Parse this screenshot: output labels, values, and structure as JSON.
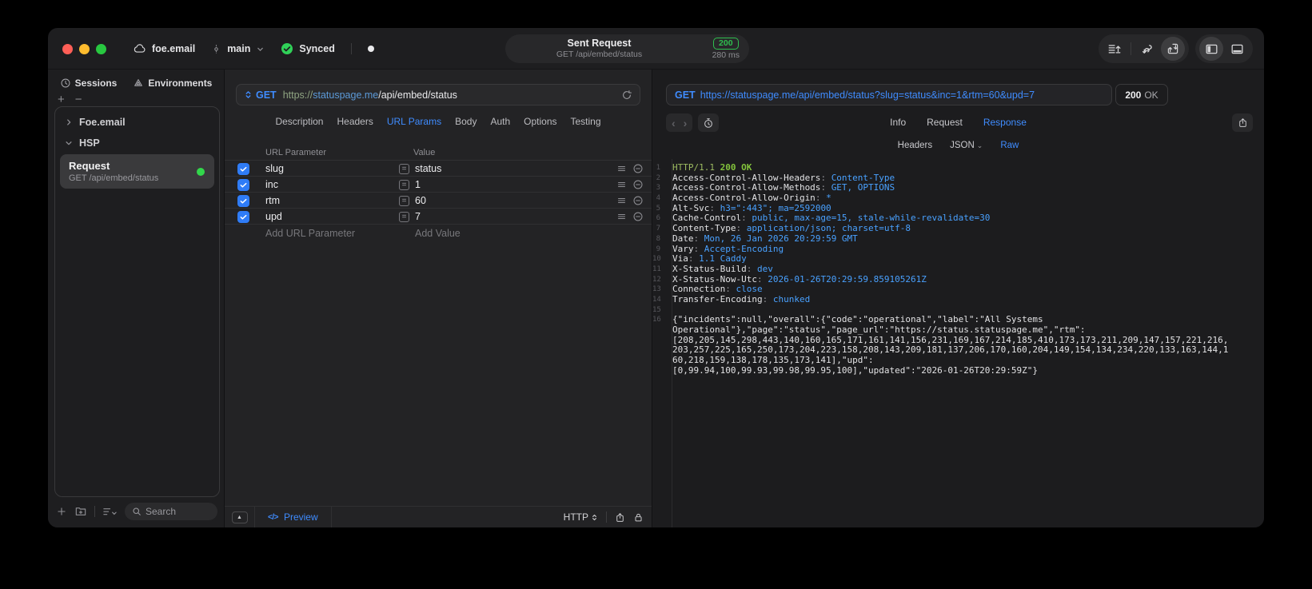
{
  "colors": {
    "accent_blue": "#3f8cff",
    "success_green": "#30d158",
    "code_value_blue": "#49a1ff",
    "code_status_green": "#83c33c"
  },
  "titlebar": {
    "project": "foe.email",
    "branch": "main",
    "sync_label": "Synced",
    "request_summary": {
      "title": "Sent Request",
      "subtitle": "GET /api/embed/status",
      "status_code": "200",
      "duration": "280 ms"
    }
  },
  "sidebar": {
    "tabs": [
      {
        "label": "Sessions",
        "icon": "history-icon"
      },
      {
        "label": "Environments",
        "icon": "environments-icon"
      }
    ],
    "tree": [
      {
        "label": "Foe.email",
        "state": "collapsed"
      },
      {
        "label": "HSP",
        "state": "expanded"
      }
    ],
    "request_item": {
      "title": "Request",
      "subtitle": "GET /api/embed/status",
      "status": "success"
    },
    "search_placeholder": "Search"
  },
  "request_editor": {
    "method": "GET",
    "url": {
      "scheme": "https://",
      "host": "statuspage.me",
      "path": "/api/embed/status"
    },
    "tabs": [
      "Description",
      "Headers",
      "URL Params",
      "Body",
      "Auth",
      "Options",
      "Testing"
    ],
    "active_tab": "URL Params",
    "params": {
      "columns": [
        "URL Parameter",
        "Value"
      ],
      "rows": [
        {
          "name": "slug",
          "value": "status",
          "checked": true
        },
        {
          "name": "inc",
          "value": "1",
          "checked": true
        },
        {
          "name": "rtm",
          "value": "60",
          "checked": true
        },
        {
          "name": "upd",
          "value": "7",
          "checked": true
        }
      ],
      "add_name_label": "Add URL Parameter",
      "add_value_label": "Add Value"
    },
    "footer": {
      "preview_label": "Preview",
      "protocol_label": "HTTP"
    }
  },
  "response_viewer": {
    "request_line": {
      "method": "GET",
      "url": "https://statuspage.me/api/embed/status?slug=status&inc=1&rtm=60&upd=7"
    },
    "status": {
      "code": "200",
      "text": "OK"
    },
    "tabs": [
      "Info",
      "Request",
      "Response"
    ],
    "active_tab": "Response",
    "subtabs": [
      "Headers",
      "JSON",
      "Raw"
    ],
    "active_subtab": "Raw",
    "raw_response": {
      "status_line": {
        "protocol": "HTTP/1.1",
        "status": "200 OK"
      },
      "headers": [
        {
          "name": "Access-Control-Allow-Headers",
          "value": "Content-Type"
        },
        {
          "name": "Access-Control-Allow-Methods",
          "value": "GET, OPTIONS"
        },
        {
          "name": "Access-Control-Allow-Origin",
          "value": "*"
        },
        {
          "name": "Alt-Svc",
          "value": "h3=\":443\"; ma=2592000"
        },
        {
          "name": "Cache-Control",
          "value": "public, max-age=15, stale-while-revalidate=30"
        },
        {
          "name": "Content-Type",
          "value": "application/json; charset=utf-8"
        },
        {
          "name": "Date",
          "value": "Mon, 26 Jan 2026 20:29:59 GMT"
        },
        {
          "name": "Vary",
          "value": "Accept-Encoding"
        },
        {
          "name": "Via",
          "value": "1.1 Caddy"
        },
        {
          "name": "X-Status-Build",
          "value": "dev"
        },
        {
          "name": "X-Status-Now-Utc",
          "value": "2026-01-26T20:29:59.859105261Z"
        },
        {
          "name": "Connection",
          "value": "close"
        },
        {
          "name": "Transfer-Encoding",
          "value": "chunked"
        }
      ],
      "body_lines": [
        "{\"incidents\":null,\"overall\":{\"code\":\"operational\",\"label\":\"All Systems",
        "Operational\"},\"page\":\"status\",\"page_url\":\"https://status.statuspage.me\",\"rtm\":",
        "[208,205,145,298,443,140,160,165,171,161,141,156,231,169,167,214,185,410,173,173,211,209,147,157,221,216,",
        "203,257,225,165,250,173,204,223,158,208,143,209,181,137,206,170,160,204,149,154,134,234,220,133,163,144,1",
        "60,218,159,138,178,135,173,141],\"upd\":",
        "[0,99.94,100,99.93,99.98,99.95,100],\"updated\":\"2026-01-26T20:29:59Z\"}"
      ]
    }
  }
}
